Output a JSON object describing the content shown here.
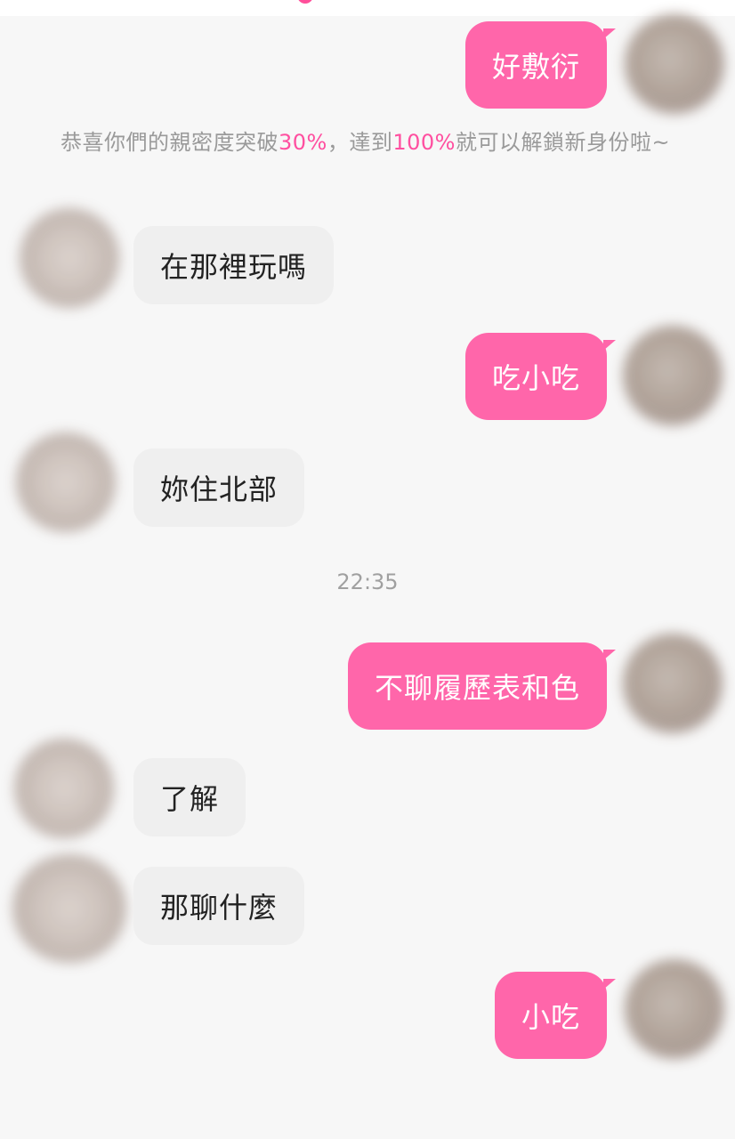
{
  "notice": {
    "part1": "恭喜你們的親密度突破",
    "percent1": "30%",
    "part2": "，達到",
    "percent2": "100%",
    "part3": "就可以解鎖新身份啦~"
  },
  "timestamp": "22:35",
  "messages": [
    {
      "sender": "self",
      "text": "好敷衍"
    },
    {
      "sender": "other",
      "text": "在那裡玩嗎"
    },
    {
      "sender": "self",
      "text": "吃小吃"
    },
    {
      "sender": "other",
      "text": "妳住北部"
    },
    {
      "sender": "self",
      "text": "不聊履歷表和色"
    },
    {
      "sender": "other",
      "text": "了解"
    },
    {
      "sender": "other",
      "text": "那聊什麼"
    },
    {
      "sender": "self",
      "text": "小吃"
    }
  ],
  "colors": {
    "self_bubble": "#ff66aa",
    "other_bubble": "#efefef",
    "highlight": "#ff4fa0",
    "background": "#f7f7f7"
  }
}
